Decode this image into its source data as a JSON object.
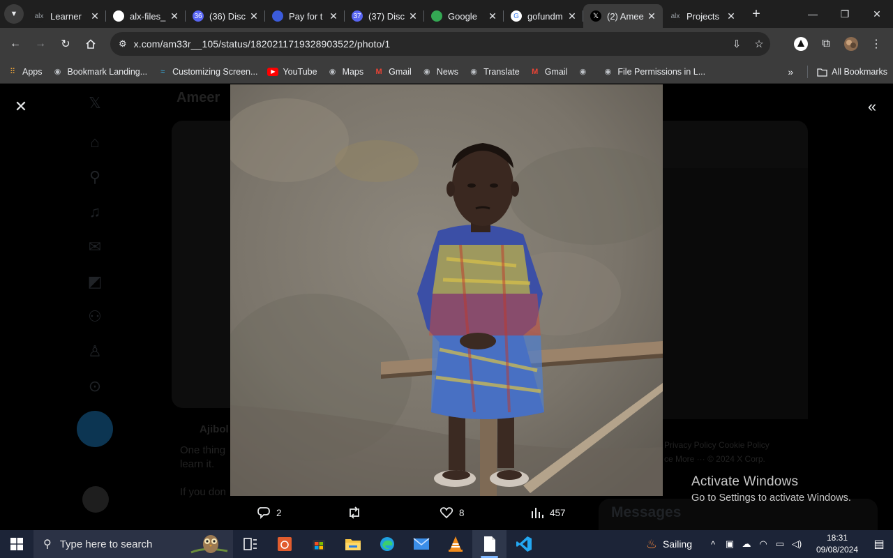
{
  "browser": {
    "tabs": [
      {
        "title": "Learner",
        "favicon": "alx-logo",
        "fav_text": "alx",
        "active": false
      },
      {
        "title": "alx-files_",
        "favicon": "github-icon",
        "fav_text": "",
        "active": false
      },
      {
        "title": "(36) Disc",
        "favicon": "discord-badge-icon",
        "fav_text": "36",
        "active": false
      },
      {
        "title": "Pay for t",
        "favicon": "gear-flower-icon",
        "fav_text": "",
        "active": false
      },
      {
        "title": "(37) Disc",
        "favicon": "discord-badge-icon",
        "fav_text": "37",
        "active": false
      },
      {
        "title": "Google",
        "favicon": "google-meet-icon",
        "fav_text": "",
        "active": false
      },
      {
        "title": "gofundm",
        "favicon": "google-icon",
        "fav_text": "G",
        "active": false
      },
      {
        "title": "(2) Amee",
        "favicon": "x-logo-icon",
        "fav_text": "𝕏",
        "active": true
      },
      {
        "title": "Projects",
        "favicon": "alx-logo",
        "fav_text": "alx",
        "active": false
      }
    ],
    "url": "x.com/am33r__105/status/1820211719328903522/photo/1",
    "bookmarks": [
      {
        "label": "Apps",
        "icon": "apps-grid-icon"
      },
      {
        "label": "Bookmark Landing...",
        "icon": "globe-icon"
      },
      {
        "label": "Customizing Screen...",
        "icon": "tailwind-icon"
      },
      {
        "label": "YouTube",
        "icon": "youtube-icon"
      },
      {
        "label": "Maps",
        "icon": "globe-icon"
      },
      {
        "label": "Gmail",
        "icon": "gmail-icon"
      },
      {
        "label": "News",
        "icon": "globe-icon"
      },
      {
        "label": "Translate",
        "icon": "globe-icon"
      },
      {
        "label": "Gmail",
        "icon": "gmail-icon"
      },
      {
        "label": "",
        "icon": "globe-icon"
      },
      {
        "label": "File Permissions in L...",
        "icon": "globe-icon"
      }
    ],
    "all_bookmarks": "All Bookmarks"
  },
  "viewer": {
    "replies": "2",
    "reposts": "",
    "likes": "8",
    "views": "457",
    "background": {
      "author_name": "Ameer",
      "reply_author": "Ajibol",
      "reply_line1": "One thing",
      "reply_line2": "learn it.",
      "reply_line3": "If you don",
      "footer_links": "Privacy Policy   Cookie Policy",
      "footer_links2": "ce   More ···   © 2024 X Corp.",
      "messages_title": "Messages"
    }
  },
  "watermark": {
    "line1": "Activate Windows",
    "line2": "Go to Settings to activate Windows."
  },
  "taskbar": {
    "search_placeholder": "Type here to search",
    "weather": "Sailing",
    "time": "18:31",
    "date": "09/08/2024"
  },
  "colors": {
    "chrome_dark": "#1f1f1f",
    "chrome_toolbar": "#3c3c3c",
    "taskbar": "#1c2437",
    "accent": "#1d9bf0"
  }
}
